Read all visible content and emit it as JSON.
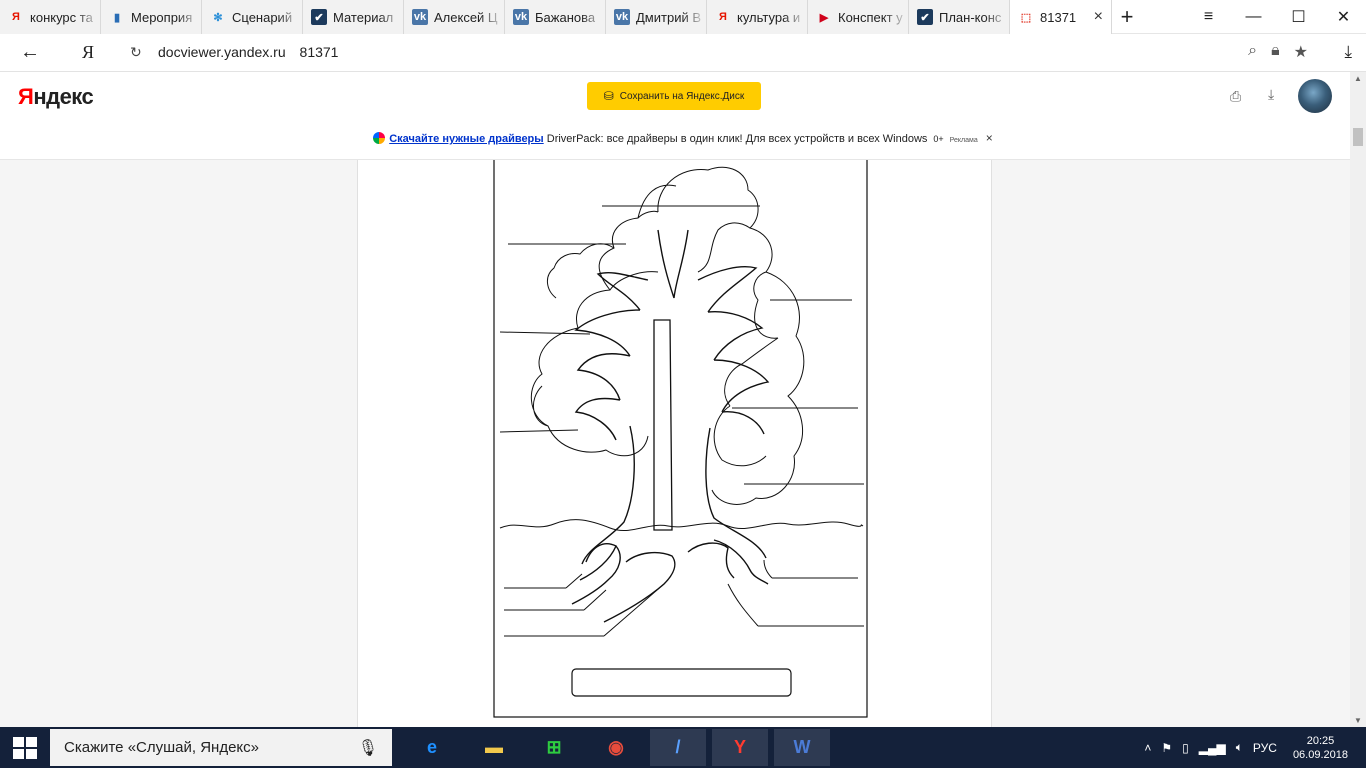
{
  "browser": {
    "tabs": [
      {
        "title": "конкурс та",
        "icon": "yandex-icon",
        "color": "#e61400"
      },
      {
        "title": "Мероприя",
        "icon": "book-icon",
        "color": "#2a6db5"
      },
      {
        "title": "Сценарий",
        "icon": "snowflake-icon",
        "color": "#2a8fd8"
      },
      {
        "title": "Материал",
        "icon": "check-icon",
        "color": "#1c3a5c"
      },
      {
        "title": "Алексей Ц",
        "icon": "vk-icon",
        "color": "#4a76a8"
      },
      {
        "title": "Бажанова",
        "icon": "vk-icon",
        "color": "#4a76a8"
      },
      {
        "title": "Дмитрий В",
        "icon": "vk-icon",
        "color": "#4a76a8"
      },
      {
        "title": "культура и",
        "icon": "yandex-icon",
        "color": "#e61400"
      },
      {
        "title": "Конспект у",
        "icon": "video-icon",
        "color": "#d0021b"
      },
      {
        "title": "План-конс",
        "icon": "check-icon",
        "color": "#1c3a5c"
      },
      {
        "title": "81371",
        "icon": "pdf-icon",
        "color": "#e23c2c"
      }
    ],
    "new_tab": "+",
    "back": "←",
    "ya_letter": "Я",
    "reload": "↻",
    "url_host": "docviewer.yandex.ru",
    "url_title": "81371"
  },
  "page": {
    "logo_ya": "Я",
    "logo_rest": "ндекс",
    "save_button": "Сохранить на Яндекс.Диск",
    "ad": {
      "link": "Скачайте нужные драйверы",
      "text": " DriverPack: все драйверы в один клик! Для всех устройств и всех Windows",
      "age": "0+",
      "label": "Реклама",
      "close": "×"
    }
  },
  "taskbar": {
    "search": "Скажите «Слушай, Яндекс»",
    "lang": "РУС",
    "time": "20:25",
    "date": "06.09.2018"
  }
}
